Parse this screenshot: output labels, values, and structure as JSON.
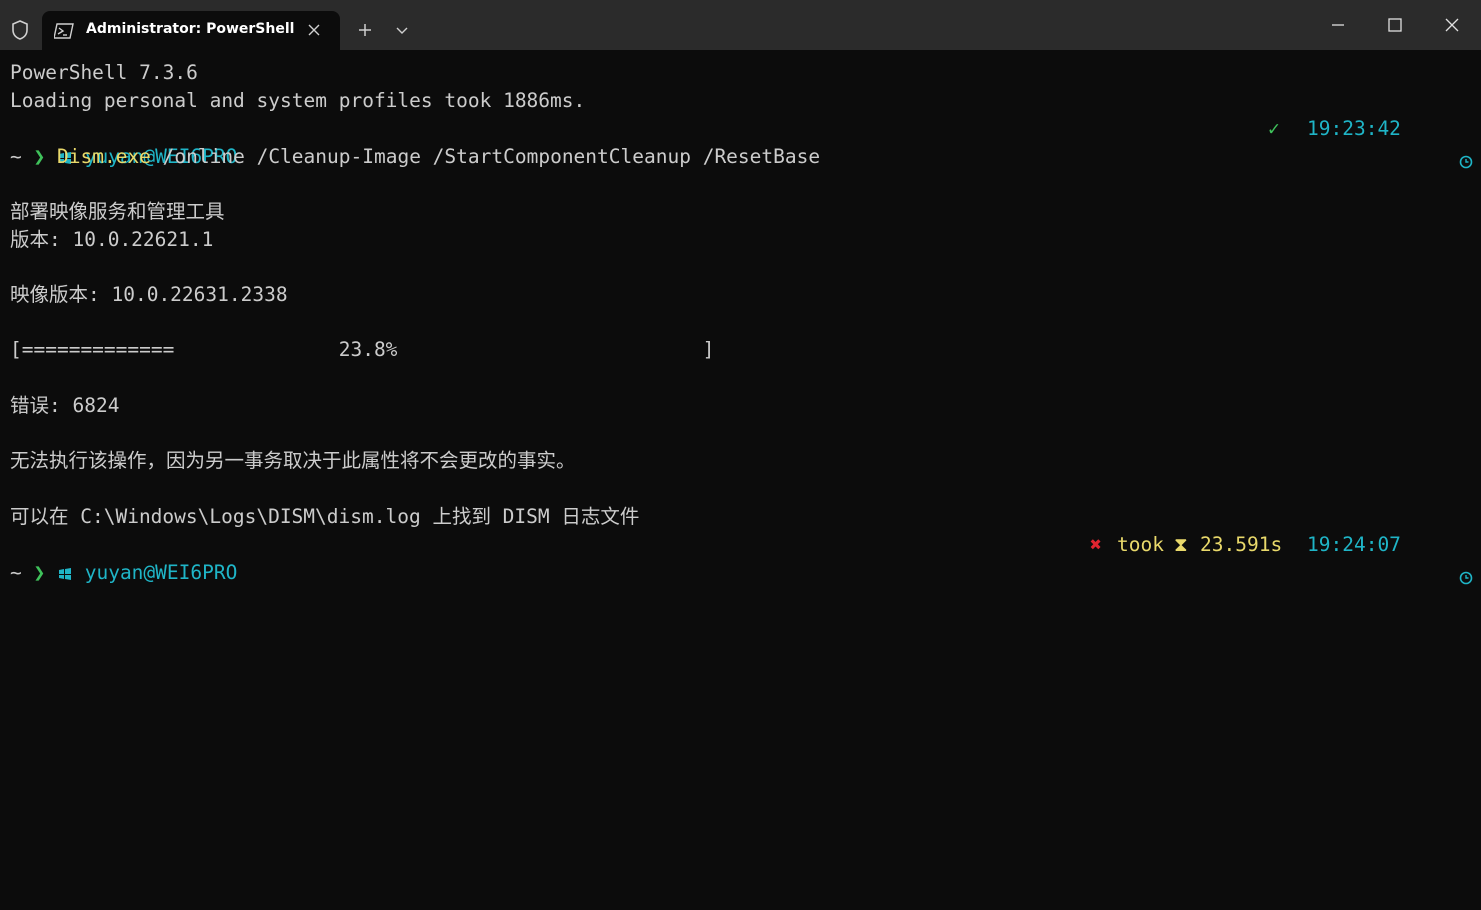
{
  "window": {
    "tab_title": "Administrator: PowerShell",
    "icons": {
      "shield": "shield-icon",
      "tab": "powershell-icon",
      "close_tab": "close-icon",
      "new_tab": "plus-icon",
      "dropdown": "chevron-down-icon",
      "minimize": "minimize-icon",
      "maximize": "maximize-icon",
      "close": "close-icon"
    }
  },
  "terminal": {
    "banner_version": "PowerShell 7.3.6",
    "banner_profiles": "Loading personal and system profiles took 1886ms.",
    "prompt1": {
      "user": "yuyan@WEI6PRO",
      "status_check": "✓",
      "time": "19:23:42",
      "dir": "~",
      "arrow": "❯",
      "command": "Dism.exe",
      "args": " /online /Cleanup-Image /StartComponentCleanup /ResetBase"
    },
    "output": {
      "tool_name": "部署映像服务和管理工具",
      "version": "版本: 10.0.22621.1",
      "image_version": "映像版本: 10.0.22631.2338",
      "progress_bar": "[=============              23.8%                          ]",
      "progress_percent": 23.8,
      "error": "错误: 6824",
      "message": "无法执行该操作，因为另一事务取决于此属性将不会更改的事实。",
      "log_hint": "可以在 C:\\Windows\\Logs\\DISM\\dism.log 上找到 DISM 日志文件"
    },
    "prompt2": {
      "user": "yuyan@WEI6PRO",
      "status_x": "✖",
      "took_label": "took",
      "hourglass": "⧗",
      "duration": "23.591s",
      "time": "19:24:07",
      "dir": "~",
      "arrow": "❯"
    },
    "colors": {
      "background": "#0c0c0c",
      "text": "#cccccc",
      "cyan": "#1fb5c7",
      "yellow": "#e9d96b",
      "green": "#3fc25b",
      "red": "#e0242f"
    }
  }
}
